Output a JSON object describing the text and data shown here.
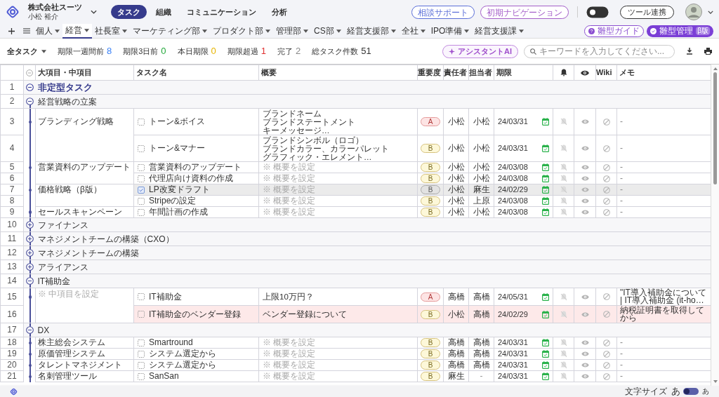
{
  "header": {
    "company": "株式会社スーツ",
    "user": "小松 裕介",
    "tabs": [
      {
        "label": "タスク",
        "selected": true
      },
      {
        "label": "組織",
        "selected": false
      },
      {
        "label": "コミュニケーション",
        "selected": false
      },
      {
        "label": "分析",
        "selected": false
      }
    ],
    "buttons": [
      {
        "label": "相談サポート",
        "color": "#5b6fd8"
      },
      {
        "label": "初期ナビゲーション",
        "color": "#a45ec9"
      }
    ],
    "theme_switch": {
      "on": false
    },
    "tool_button": "ツール連携"
  },
  "departments": {
    "items": [
      {
        "label": "個人",
        "selected": false
      },
      {
        "label": "経営",
        "selected": true
      },
      {
        "label": "社長室",
        "selected": false
      },
      {
        "label": "マーケティング部",
        "selected": false
      },
      {
        "label": "プロダクト部",
        "selected": false
      },
      {
        "label": "管理部",
        "selected": false
      },
      {
        "label": "CS部",
        "selected": false
      },
      {
        "label": "経営支援部",
        "selected": false
      },
      {
        "label": "全社",
        "selected": false
      },
      {
        "label": "IPO準備",
        "selected": false
      },
      {
        "label": "経営支援課",
        "selected": false
      }
    ],
    "guide_button": "雛型ガイド",
    "manage_button": "雛型管理",
    "manage_badge": "β版"
  },
  "filters": {
    "scope": "全タスク",
    "stats": [
      {
        "label": "期限一週間前",
        "count": "8",
        "color": "#3b82f6"
      },
      {
        "label": "期限3日前",
        "count": "0",
        "color": "#22a83a"
      },
      {
        "label": "本日期限",
        "count": "0",
        "color": "#e6b400"
      },
      {
        "label": "期限超過",
        "count": "1",
        "color": "#e03131"
      },
      {
        "label": "完了",
        "count": "2",
        "color": "#888888"
      },
      {
        "label": "総タスク件数",
        "count": "51",
        "color": "#333333"
      }
    ],
    "assistant_button": "アシスタントAI",
    "search": {
      "placeholder": "キーワードを入力してください..."
    }
  },
  "table": {
    "columns": [
      "大項目・中項目",
      "タスク名",
      "概要",
      "重要度",
      "責任者",
      "担当者",
      "期限",
      "Wiki",
      "メモ"
    ],
    "rows": [
      {
        "kind": "section",
        "num": "1",
        "label": "非定型タスク",
        "expanded": true
      },
      {
        "kind": "group",
        "num": "2",
        "label": "経営戦略の立案",
        "expanded": true,
        "categories": [
          {
            "name": "ブランディング戦略",
            "tasks": [
              {
                "num": "3",
                "name": "トーン&ボイス",
                "checked": false,
                "overdue": false,
                "summary_lines": [
                  "ブランドネーム",
                  "ブランドステートメント",
                  "キーメッセージ…"
                ],
                "priority": "A",
                "owner": "小松",
                "assignee": "小松",
                "due": "24/03/31",
                "memo_lines": [
                  "-"
                ]
              },
              {
                "num": "4",
                "name": "トーン&マナー",
                "checked": false,
                "overdue": false,
                "summary_lines": [
                  "ブランドシンボル（ロゴ）",
                  "ブランドカラー、カラーパレット",
                  "グラフィック・エレメント…"
                ],
                "priority": "B",
                "owner": "小松",
                "assignee": "小松",
                "due": "24/03/31",
                "memo_lines": [
                  "-"
                ]
              }
            ]
          },
          {
            "name": "営業資料のアップデート",
            "tasks": [
              {
                "num": "5",
                "name": "営業資料のアップデート",
                "checked": false,
                "overdue": false,
                "summary_hint": "※ 概要を設定",
                "priority": "B",
                "owner": "小松",
                "assignee": "小松",
                "due": "24/03/08",
                "memo_lines": [
                  "-"
                ]
              },
              {
                "num": "6",
                "name": "代理店向け資料の作成",
                "checked": false,
                "overdue": false,
                "summary_hint": "※ 概要を設定",
                "priority": "B",
                "owner": "小松",
                "assignee": "小松",
                "due": "24/03/08",
                "memo_lines": [
                  "-"
                ]
              }
            ]
          },
          {
            "name": "価格戦略（β版）",
            "tasks": [
              {
                "num": "7",
                "name": "LP改変ドラフト",
                "checked": true,
                "overdue": false,
                "summary_hint": "※ 概要を設定",
                "priority": "B",
                "owner": "小松",
                "assignee": "麻生",
                "due": "24/02/29",
                "memo_lines": [
                  "-"
                ]
              },
              {
                "num": "8",
                "name": "Stripeの設定",
                "checked": false,
                "overdue": false,
                "summary_hint": "※ 概要を設定",
                "priority": "B",
                "owner": "小松",
                "assignee": "上原",
                "due": "24/03/08",
                "memo_lines": [
                  "-"
                ]
              }
            ]
          },
          {
            "name": "セールスキャンペーン",
            "tasks": [
              {
                "num": "9",
                "name": "年間計画の作成",
                "checked": false,
                "overdue": false,
                "summary_hint": "※ 概要を設定",
                "priority": "B",
                "owner": "小松",
                "assignee": "小松",
                "due": "24/03/08",
                "memo_lines": [
                  "-"
                ]
              }
            ]
          }
        ]
      },
      {
        "kind": "group",
        "num": "10",
        "label": "ファイナンス",
        "expanded": false
      },
      {
        "kind": "group",
        "num": "11",
        "label": "マネジメントチームの構築（CXO）",
        "expanded": false
      },
      {
        "kind": "group",
        "num": "12",
        "label": "マネジメントチームの構築",
        "expanded": false
      },
      {
        "kind": "group",
        "num": "13",
        "label": "アライアンス",
        "expanded": false
      },
      {
        "kind": "group",
        "num": "14",
        "label": "IT補助金",
        "expanded": true,
        "categories": [
          {
            "hint": "※ 中項目を設定",
            "tasks": [
              {
                "num": "15",
                "name": "IT補助金",
                "checked": false,
                "overdue": false,
                "summary_lines": [
                  "上限10万円？"
                ],
                "priority": "A",
                "owner": "高橋",
                "assignee": "高橋",
                "due": "24/05/31",
                "memo_lines": [
                  "\"IT導入補助金について",
                  "| IT導入補助金 (it-ho…"
                ]
              },
              {
                "num": "16",
                "name": "IT補助金のベンダー登録",
                "checked": false,
                "overdue": true,
                "summary_lines": [
                  "ベンダー登録について"
                ],
                "priority": "B",
                "owner": "小松",
                "assignee": "高橋",
                "due": "24/02/29",
                "memo_lines": [
                  "納税証明書を取得して",
                  "から"
                ]
              }
            ]
          }
        ]
      },
      {
        "kind": "group",
        "num": "17",
        "label": "DX",
        "expanded": true,
        "categories": [
          {
            "name": "株主総会システム",
            "tasks": [
              {
                "num": "18",
                "name": "Smartround",
                "checked": false,
                "overdue": false,
                "summary_hint": "※ 概要を設定",
                "priority": "B",
                "owner": "高橋",
                "assignee": "高橋",
                "due": "24/03/31",
                "memo_lines": [
                  "-"
                ]
              }
            ]
          },
          {
            "name": "原価管理システム",
            "tasks": [
              {
                "num": "19",
                "name": "システム選定から",
                "checked": false,
                "overdue": false,
                "summary_hint": "※ 概要を設定",
                "priority": "B",
                "owner": "高橋",
                "assignee": "高橋",
                "due": "24/03/31",
                "memo_lines": [
                  "-"
                ]
              }
            ]
          },
          {
            "name": "タレントマネジメント",
            "tasks": [
              {
                "num": "20",
                "name": "システム選定から",
                "checked": false,
                "overdue": false,
                "summary_hint": "※ 概要を設定",
                "priority": "B",
                "owner": "高橋",
                "assignee": "高橋",
                "due": "24/03/31",
                "memo_lines": [
                  "-"
                ]
              }
            ]
          },
          {
            "name": "名刺管理ツール",
            "tasks": [
              {
                "num": "21",
                "name": "SanSan",
                "checked": false,
                "overdue": false,
                "summary_hint": "※ 概要を設定",
                "priority": "B",
                "owner": "麻生",
                "assignee": "-",
                "due": "24/03/31",
                "memo_lines": [
                  "-"
                ]
              }
            ]
          }
        ]
      }
    ]
  },
  "footer": {
    "font_size_label": "文字サイズ",
    "large": "あ",
    "small": "あ",
    "small_size": {
      "on": false
    }
  }
}
